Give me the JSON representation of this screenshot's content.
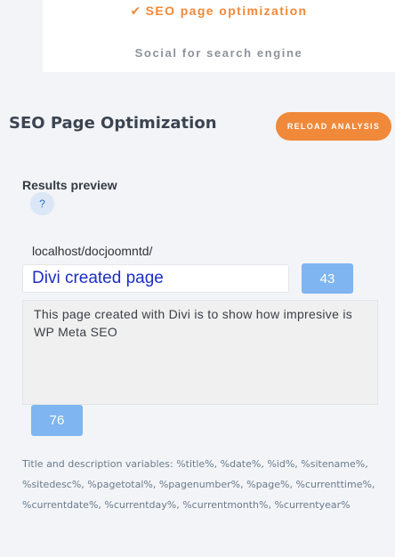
{
  "tabs": {
    "active_label": "SEO page optimization",
    "active_icon": "check-icon",
    "social_label": "Social for search engine"
  },
  "header": {
    "title": "SEO Page Optimization",
    "reload_label": "RELOAD ANALYSIS"
  },
  "preview": {
    "label": "Results preview",
    "help_glyph": "?",
    "url": "localhost/docjoomntd/",
    "title_value": "Divi created page",
    "title_count": "43",
    "description_value": "This page created with Divi is to show how impresive is WP Meta SEO",
    "description_count": "76"
  },
  "variables": {
    "text": "Title and description variables: %title%, %date%, %id%, %sitename%, %sitedesc%, %pagetotal%, %pagenumber%, %page%, %currenttime%, %currentdate%, %currentday%, %currentmonth%, %currentyear%"
  },
  "colors": {
    "accent": "#f0893a",
    "counter": "#7fb5f0",
    "link_title": "#1b2ec4",
    "background": "#f2f4f8"
  }
}
